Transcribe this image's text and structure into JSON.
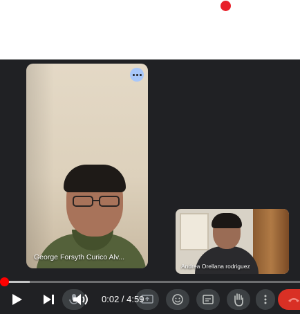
{
  "recording": {
    "indicator_color": "#e8202a"
  },
  "participants": [
    {
      "name": "George Forsyth Curico Alv..."
    },
    {
      "name": "Andrea Orellana rodriguez"
    }
  ],
  "player": {
    "current_time": "0:02",
    "separator": " / ",
    "duration": "4:59",
    "progress_fraction": 0.007,
    "buffered_fraction": 0.1
  },
  "icons": {
    "play": "play-icon",
    "next": "next-icon",
    "volume": "volume-icon",
    "more": "more-options-icon"
  },
  "colors": {
    "background": "#202124",
    "accent": "#ff0000",
    "end_call": "#d93025",
    "more_button": "#a8c7fa"
  }
}
